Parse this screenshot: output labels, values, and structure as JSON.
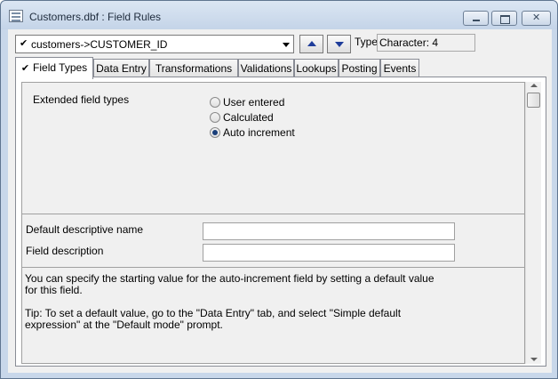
{
  "window": {
    "title": "Customers.dbf : Field Rules"
  },
  "field_selector": {
    "value": "customers->CUSTOMER_ID",
    "type_label": "Type:",
    "type_value": "Character: 4"
  },
  "tabs": [
    {
      "label": "Field Types",
      "active": true
    },
    {
      "label": "Data Entry",
      "active": false
    },
    {
      "label": "Transformations",
      "active": false
    },
    {
      "label": "Validations",
      "active": false
    },
    {
      "label": "Lookups",
      "active": false
    },
    {
      "label": "Posting",
      "active": false
    },
    {
      "label": "Events",
      "active": false
    }
  ],
  "field_types": {
    "extended_label": "Extended field types",
    "options": [
      {
        "label": "User entered",
        "selected": false
      },
      {
        "label": "Calculated",
        "selected": false
      },
      {
        "label": "Auto increment",
        "selected": true
      }
    ]
  },
  "descriptive": {
    "name_label": "Default descriptive name",
    "name_value": "",
    "description_label": "Field description",
    "description_value": ""
  },
  "info": {
    "paragraph1": "You can specify the starting value for the auto-increment field by setting a default value for this field.",
    "paragraph2": "Tip: To set a default value, go to the \"Data Entry\" tab, and select \"Simple default expression\" at the \"Default mode\" prompt."
  }
}
